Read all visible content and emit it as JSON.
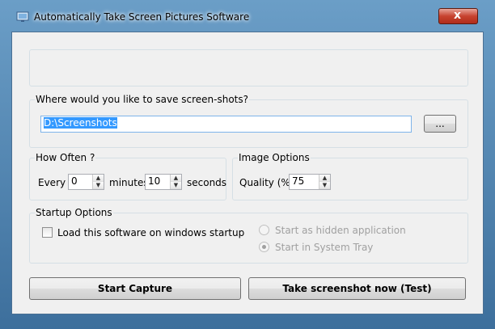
{
  "window": {
    "title": "Automatically Take Screen Pictures Software",
    "close_label": "x"
  },
  "save_group": {
    "label": "Where would you like to save screen-shots?",
    "path_value": "D:\\Screenshots",
    "browse_label": "..."
  },
  "how_often": {
    "label": "How Often ?",
    "every_label": "Every",
    "minutes_value": "0",
    "minutes_label": "minutes",
    "seconds_value": "10",
    "seconds_label": "seconds"
  },
  "image_options": {
    "label": "Image Options",
    "quality_label": "Quality (%):",
    "quality_value": "75"
  },
  "startup": {
    "label": "Startup Options",
    "load_on_startup_label": "Load this software on windows startup",
    "load_on_startup_checked": false,
    "radio_hidden_label": "Start as hidden application",
    "radio_tray_label": "Start in System Tray",
    "selected_radio": "tray"
  },
  "actions": {
    "start_capture_label": "Start Capture",
    "test_label": "Take screenshot now (Test)"
  }
}
